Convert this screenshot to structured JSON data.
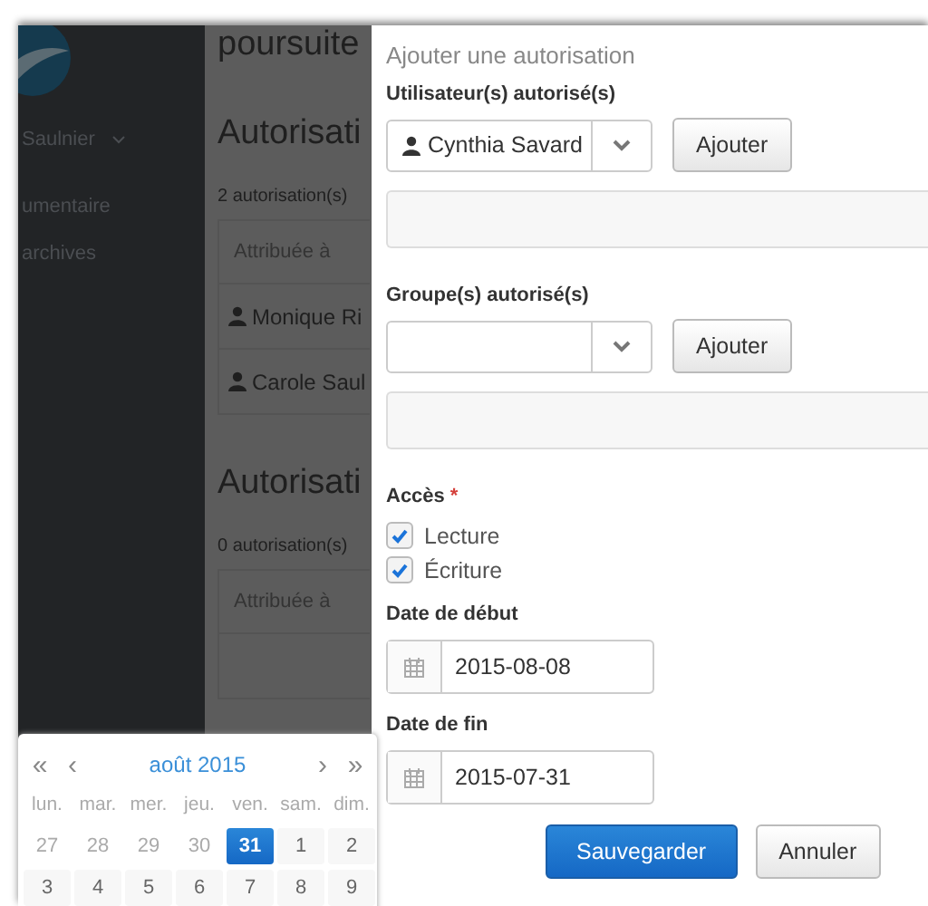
{
  "sidebar": {
    "user": "Saulnier",
    "items": [
      "umentaire",
      "archives"
    ]
  },
  "page": {
    "title": "poursuite",
    "sections": [
      {
        "heading": "Autorisati",
        "count": "2 autorisation(s)",
        "column": "Attribuée à",
        "rows": [
          "Monique Ri",
          "Carole Saul"
        ]
      },
      {
        "heading": "Autorisati",
        "count": "0 autorisation(s)",
        "column": "Attribuée à"
      }
    ]
  },
  "modal": {
    "title": "Ajouter une autorisation",
    "users": {
      "label": "Utilisateur(s) autorisé(s)",
      "value": "Cynthia Savard",
      "button": "Ajouter"
    },
    "groups": {
      "label": "Groupe(s) autorisé(s)",
      "button": "Ajouter"
    },
    "access": {
      "label": "Accès",
      "required_mark": "*",
      "options": [
        {
          "label": "Lecture",
          "checked": true
        },
        {
          "label": "Écriture",
          "checked": true
        }
      ]
    },
    "start": {
      "label": "Date de début",
      "value": "2015-08-08"
    },
    "end": {
      "label": "Date de fin",
      "value": "2015-07-31"
    },
    "buttons": [
      {
        "label": "Sauvegarder",
        "kind": "primary"
      },
      {
        "label": "Annuler",
        "kind": "default"
      }
    ]
  },
  "calendar": {
    "prev_year": "«",
    "prev": "‹",
    "month": "août 2015",
    "next": "›",
    "next_year": "»",
    "weekdays": [
      "lun.",
      "mar.",
      "mer.",
      "jeu.",
      "ven.",
      "sam.",
      "dim."
    ],
    "weeks": [
      [
        {
          "day": "27",
          "other_month": true,
          "selected": false
        },
        {
          "day": "28",
          "other_month": true,
          "selected": false
        },
        {
          "day": "29",
          "other_month": true,
          "selected": false
        },
        {
          "day": "30",
          "other_month": true,
          "selected": false
        },
        {
          "day": "31",
          "other_month": true,
          "selected": true
        },
        {
          "day": "1",
          "other_month": false,
          "selected": false
        },
        {
          "day": "2",
          "other_month": false,
          "selected": false
        }
      ],
      [
        {
          "day": "3",
          "other_month": false,
          "selected": false
        },
        {
          "day": "4",
          "other_month": false,
          "selected": false
        },
        {
          "day": "5",
          "other_month": false,
          "selected": false
        },
        {
          "day": "6",
          "other_month": false,
          "selected": false
        },
        {
          "day": "7",
          "other_month": false,
          "selected": false
        },
        {
          "day": "8",
          "other_month": false,
          "selected": false
        },
        {
          "day": "9",
          "other_month": false,
          "selected": false
        }
      ]
    ]
  }
}
